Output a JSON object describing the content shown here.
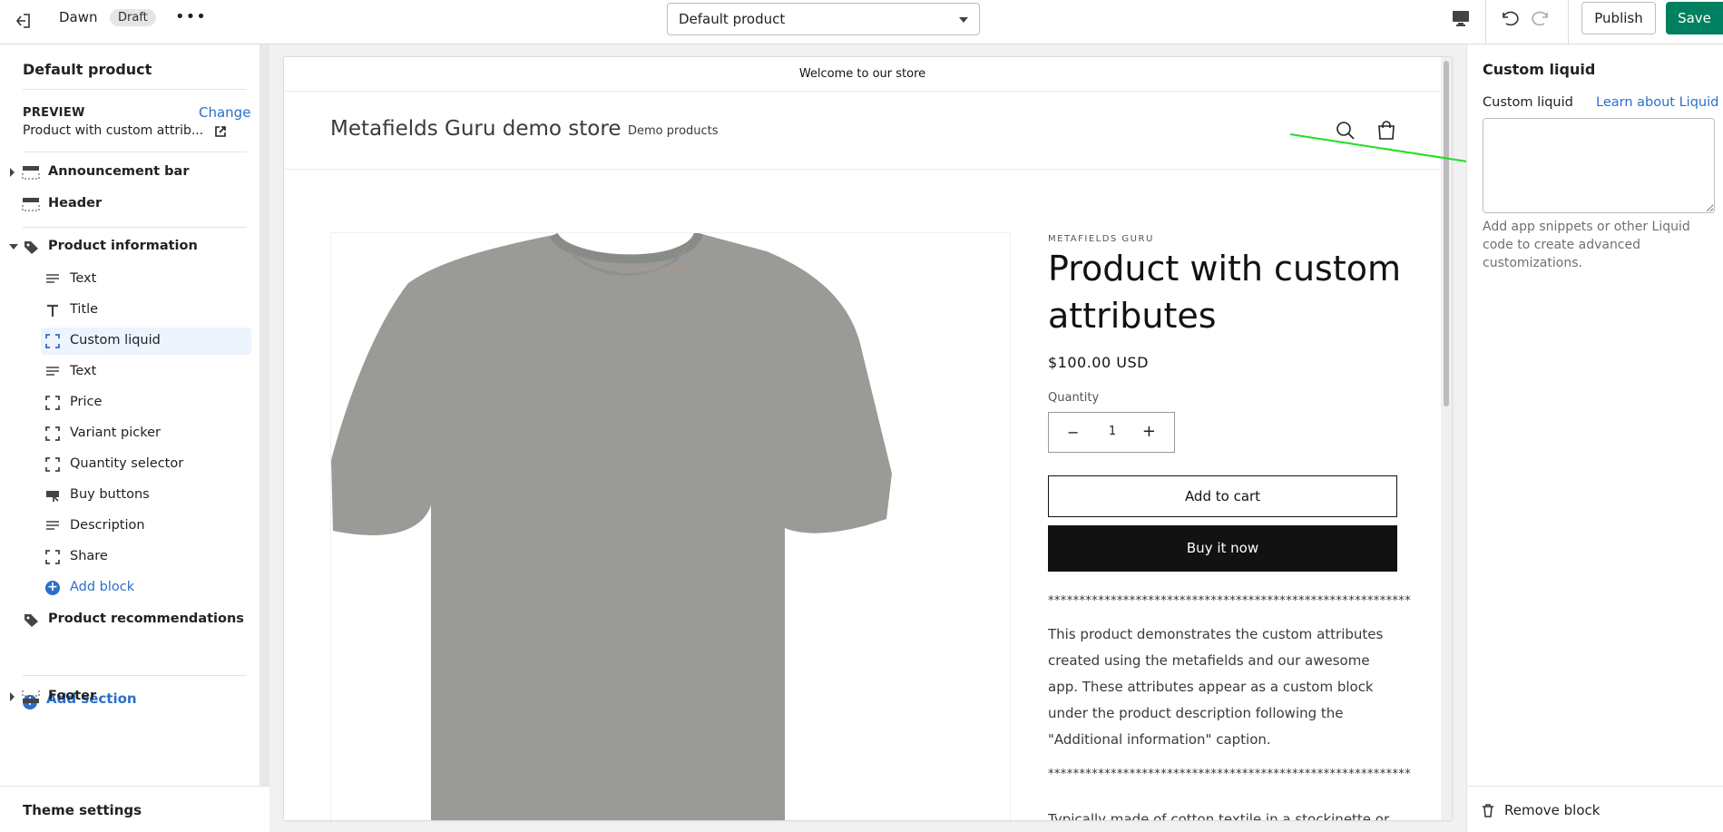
{
  "topbar": {
    "theme_name": "Dawn",
    "status_badge": "Draft",
    "template_select": "Default product",
    "publish_label": "Publish",
    "save_label": "Save"
  },
  "sidebar": {
    "title": "Default product",
    "preview_label": "PREVIEW",
    "change_label": "Change",
    "preview_product": "Product with custom attrib...",
    "sections": {
      "announcement": "Announcement bar",
      "header": "Header",
      "product_information": "Product information",
      "product_recommendations": "Product recommendations",
      "footer": "Footer"
    },
    "blocks": [
      "Text",
      "Title",
      "Custom liquid",
      "Text",
      "Price",
      "Variant picker",
      "Quantity selector",
      "Buy buttons",
      "Description",
      "Share"
    ],
    "add_block": "Add block",
    "add_section": "Add section",
    "theme_settings": "Theme settings"
  },
  "store": {
    "announcement": "Welcome to our store",
    "name": "Metafields Guru demo store",
    "nav_link": "Demo products",
    "vendor": "METAFIELDS GURU",
    "product_title": "Product with custom attributes",
    "price": "$100.00 USD",
    "quantity_label": "Quantity",
    "quantity_value": "1",
    "minus": "−",
    "plus": "+",
    "add_to_cart": "Add to cart",
    "buy_now": "Buy it now",
    "stars": "**********************************************************",
    "description": "This product demonstrates the custom attributes created using the metafields and our awesome app. These attributes appear as a custom block under the product description following the \"Additional information\" caption.",
    "stars2": "**********************************************************",
    "description2": "Typically made of cotton textile in a stockinette or"
  },
  "right_panel": {
    "title": "Custom liquid",
    "field_label": "Custom liquid",
    "learn_link": "Learn about Liquid",
    "textarea_value": "",
    "help_text": "Add app snippets or other Liquid code to create advanced customizations.",
    "remove_block": "Remove block"
  },
  "colors": {
    "save_green": "#008060",
    "link_blue": "#2c6ecb",
    "arrow_green": "#22dd22",
    "tshirt_gray": "#9a9a97"
  },
  "icons": {
    "exit": "exit-icon",
    "more": "more-horizontal-icon",
    "device": "desktop-icon",
    "undo": "undo-icon",
    "redo": "redo-icon",
    "search": "search-icon",
    "cart": "cart-icon",
    "trash": "trash-icon"
  }
}
